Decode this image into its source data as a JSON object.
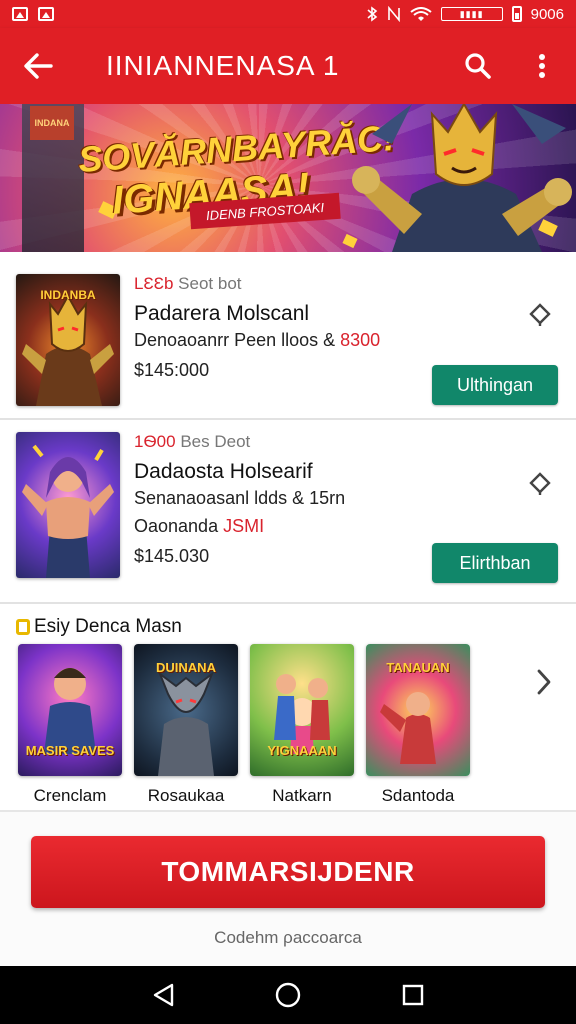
{
  "status_bar": {
    "time": "9006",
    "icons": [
      "image-icon",
      "photo-icon",
      "bluetooth-icon",
      "nfc-icon",
      "wifi-icon",
      "data-box-icon",
      "battery-icon"
    ]
  },
  "app_bar": {
    "title": "IINIANNENASA 1",
    "icons": [
      "back-arrow-icon",
      "search-icon",
      "more-vert-icon"
    ],
    "color": "#e01f25"
  },
  "banner": {
    "title_line1": "SOVĂRNBAYRĂC!",
    "title_line2": "IGNAASA!",
    "tagline": "IDENB FROSTOAKI",
    "machine_label": "INDANA"
  },
  "products": [
    {
      "meta_red": "LƐƐb",
      "meta_gray": " Seot bot",
      "title": "Padarera Molscanl",
      "desc": "Denoaoanrr Peen lloos & ",
      "desc_red": "8300",
      "extra": "",
      "extra_red": "",
      "price": "$145:000",
      "thumb_label": "INDANBA",
      "button": "Ulthingan"
    },
    {
      "meta_red": "1Ѳ00",
      "meta_gray": " Bes Deot",
      "title": "Dadaosta Holsearif",
      "desc": "Senanaoasanl ldds & 15rn",
      "desc_red": "",
      "extra": "Oaonanda ",
      "extra_red": "JSMI",
      "price": "$145.030",
      "thumb_label": "",
      "button": "Elirthban"
    }
  ],
  "section": {
    "title": "Esiy Denca Masn",
    "tiles": [
      {
        "label": "Crenclam",
        "top_text": "",
        "bottom_text": "MASIR SAVES"
      },
      {
        "label": "Rosaukaa",
        "top_text": "DUINANA",
        "bottom_text": ""
      },
      {
        "label": "Natkarn",
        "top_text": "",
        "bottom_text": "YIGNAAAN"
      },
      {
        "label": "Sdantoda",
        "top_text": "TANAUAN",
        "bottom_text": ""
      }
    ]
  },
  "cta": {
    "label": "TOMMARSIJDENR",
    "sub_link": "Codehm ρaccoarca",
    "color": "#e01f25"
  },
  "accent_green": "#11876a"
}
